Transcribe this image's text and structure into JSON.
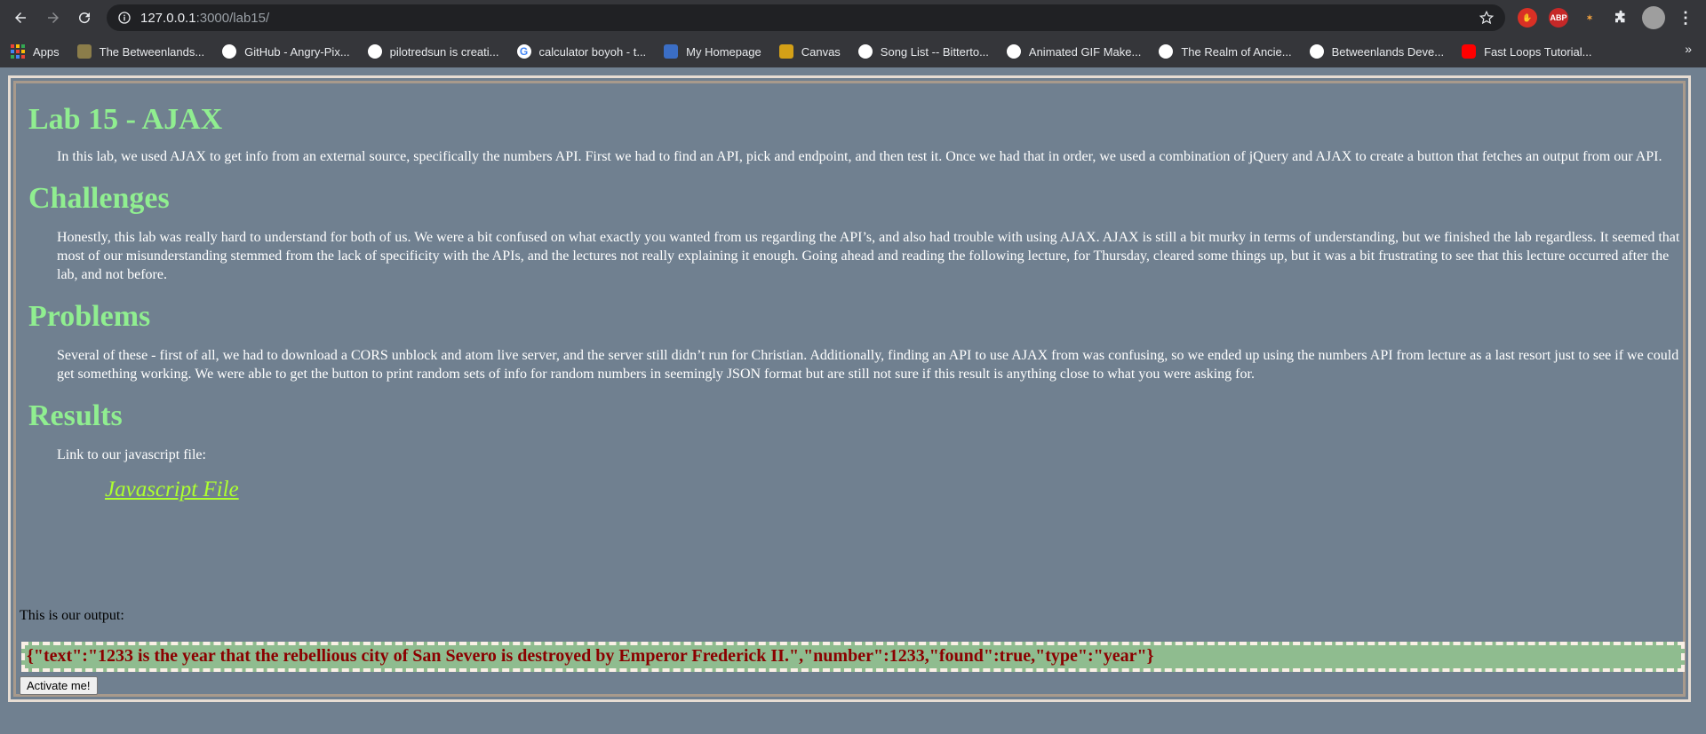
{
  "browser": {
    "url_host": "127.0.0.1",
    "url_rest": ":3000/lab15/",
    "bookmarks": [
      {
        "label": "Apps",
        "icon": "apps-icon",
        "color": ""
      },
      {
        "label": "The Betweenlands...",
        "icon": "betweenlands-icon",
        "color": "#8b7d4a"
      },
      {
        "label": "GitHub - Angry-Pix...",
        "icon": "github-icon",
        "color": "#ffffff"
      },
      {
        "label": "pilotredsun is creati...",
        "icon": "globe-icon",
        "color": "#ffffff"
      },
      {
        "label": "calculator boyoh - t...",
        "icon": "google-icon",
        "color": "#4285f4"
      },
      {
        "label": "My Homepage",
        "icon": "ucsc-icon",
        "color": "#3b6ec5"
      },
      {
        "label": "Canvas",
        "icon": "canvas-icon",
        "color": "#d4a017"
      },
      {
        "label": "Song List -- Bitterto...",
        "icon": "bitter-icon",
        "color": "#ffffff"
      },
      {
        "label": "Animated GIF Make...",
        "icon": "globe-icon",
        "color": "#ffffff"
      },
      {
        "label": "The Realm of Ancie...",
        "icon": "globe-icon",
        "color": "#ffffff"
      },
      {
        "label": "Betweenlands Deve...",
        "icon": "github-icon",
        "color": "#ffffff"
      },
      {
        "label": "Fast Loops Tutorial...",
        "icon": "youtube-icon",
        "color": "#ff0000"
      }
    ],
    "more": "»",
    "ext_abp": "ABP"
  },
  "page": {
    "sections": [
      {
        "heading": "Lab 15 - AJAX",
        "text": "In this lab, we used AJAX to get info from an external source, specifically the numbers API. First we had to find an API, pick and endpoint, and then test it. Once we had that in order, we used a combination of jQuery and AJAX to create a button that fetches an output from our API."
      },
      {
        "heading": "Challenges",
        "text": "Honestly, this lab was really hard to understand for both of us. We were a bit confused on what exactly you wanted from us regarding the API’s, and also had trouble with using AJAX. AJAX is still a bit murky in terms of understanding, but we finished the lab regardless. It seemed that most of our misunderstanding stemmed from the lack of specificity with the APIs, and the lectures not really explaining it enough. Going ahead and reading the following lecture, for Thursday, cleared some things up, but it was a bit frustrating to see that this lecture occurred after the lab, and not before."
      },
      {
        "heading": "Problems",
        "text": "Several of these - first of all, we had to download a CORS unblock and atom live server, and the server still didn’t run for Christian. Additionally, finding an API to use AJAX from was confusing, so we ended up using the numbers API from lecture as a last resort just to see if we could get something working. We were able to get the button to print random sets of info for random numbers in seemingly JSON format but are still not sure if this result is anything close to what you were asking for."
      },
      {
        "heading": "Results",
        "text": "Link to our javascript file:"
      }
    ],
    "js_link": "Javascript File",
    "output_label": "This is our output:",
    "output": "{\"text\":\"1233 is the year that the rebellious city of San Severo is destroyed by Emperor Frederick II.\",\"number\":1233,\"found\":true,\"type\":\"year\"}",
    "button": "Activate me!"
  },
  "colors": {
    "background": "#708090",
    "heading": "#90ee90",
    "link": "#adff2f",
    "output_bg": "#8fbc8f",
    "output_text": "#8b0000"
  }
}
